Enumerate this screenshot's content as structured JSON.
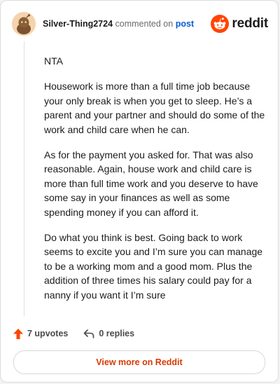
{
  "header": {
    "username": "Silver-Thing2724",
    "action_text": "commented on",
    "post_link": "post",
    "brand_name": "reddit"
  },
  "comment": {
    "paragraphs": [
      "NTA",
      "Housework is more than a full time job because your only break is when you get to sleep. He’s a parent and your partner and should do some of the work and child care when he can.",
      "As for the payment you asked for. That was also reasonable. Again, house work and child care is more than full time work and you deserve to have some say in your finances as well as some spending money if you can afford it.",
      "Do what you think is best. Going back to work seems to excite you and I’m sure you can manage to be a working mom and a good mom. Plus the addition of three times his salary could pay for a nanny if you want it I’m sure"
    ]
  },
  "actions": {
    "upvotes": "7 upvotes",
    "replies": "0 replies"
  },
  "footer": {
    "view_more": "View more on Reddit"
  },
  "colors": {
    "brand_orange": "#ff4500",
    "link_blue": "#0a5bd3",
    "view_more_text": "#d93a00"
  },
  "icons": [
    "user-avatar",
    "reddit-logo-icon",
    "upvote-arrow-icon",
    "reply-icon"
  ]
}
